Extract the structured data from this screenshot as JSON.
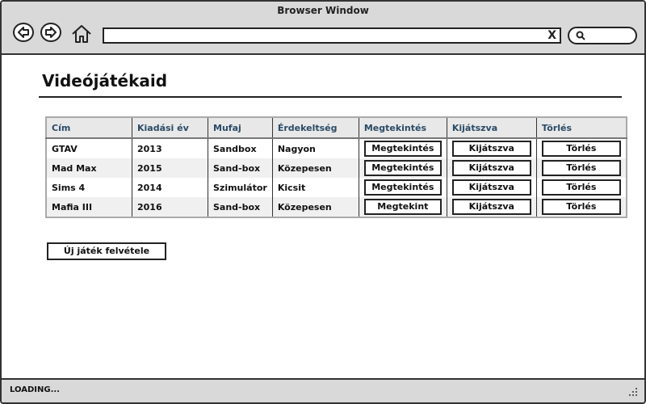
{
  "window": {
    "title": "Browser Window"
  },
  "nav": {
    "back_icon": "back-arrow-icon",
    "forward_icon": "forward-arrow-icon",
    "home_icon": "home-icon",
    "clear_glyph": "X",
    "search_icon": "magnifier-icon"
  },
  "page": {
    "title": "Videójátékaid"
  },
  "table": {
    "headers": [
      "Cím",
      "Kiadási év",
      "Mufaj",
      "Érdekeltség",
      "Megtekintés",
      "Kijátszva",
      "Törlés"
    ],
    "rows": [
      {
        "title": "GTAV",
        "year": "2013",
        "genre": "Sandbox",
        "interest": "Nagyon",
        "view": "Megtekintés",
        "played": "Kijátszva",
        "delete": "Törlés"
      },
      {
        "title": "Mad Max",
        "year": "2015",
        "genre": "Sand-box",
        "interest": "Közepesen",
        "view": "Megtekintés",
        "played": "Kijátszva",
        "delete": "Törlés"
      },
      {
        "title": "Sims 4",
        "year": "2014",
        "genre": "Szimulátor",
        "interest": "Kicsit",
        "view": "Megtekintés",
        "played": "Kijátszva",
        "delete": "Törlés"
      },
      {
        "title": "Mafia III",
        "year": "2016",
        "genre": "Sand-box",
        "interest": "Közepesen",
        "view": "Megtekint",
        "played": "Kijátszva",
        "delete": "Törlés"
      }
    ]
  },
  "actions": {
    "new_game": "Új játék felvétele"
  },
  "status": {
    "text": "LOADING..."
  }
}
